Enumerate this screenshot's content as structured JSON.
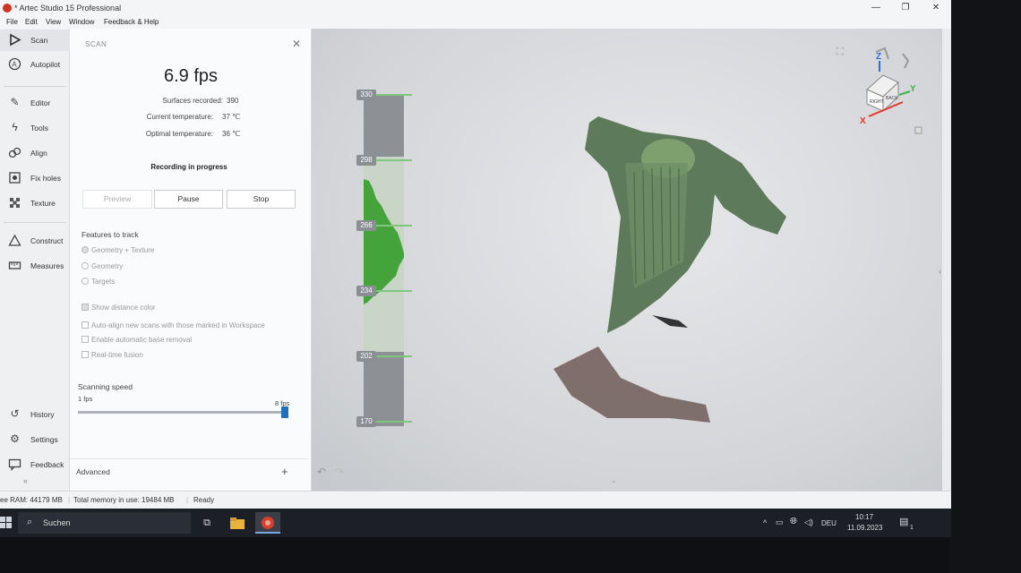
{
  "window": {
    "title": "* Artec Studio 15 Professional"
  },
  "menu": [
    "File",
    "Edit",
    "View",
    "Window",
    "Feedback & Help"
  ],
  "sidebar": {
    "top": [
      {
        "label": "Scan",
        "icon": "play-icon"
      },
      {
        "label": "Autopilot",
        "icon": "autopilot-icon"
      }
    ],
    "middle": [
      {
        "label": "Editor",
        "icon": "pencil-icon"
      },
      {
        "label": "Tools",
        "icon": "lightning-icon"
      },
      {
        "label": "Align",
        "icon": "align-icon"
      },
      {
        "label": "Fix holes",
        "icon": "fix-holes-icon"
      },
      {
        "label": "Texture",
        "icon": "texture-icon"
      }
    ],
    "lower": [
      {
        "label": "Construct",
        "icon": "triangle-icon"
      },
      {
        "label": "Measures",
        "icon": "ruler-icon"
      }
    ],
    "bottom": [
      {
        "label": "History",
        "icon": "history-icon"
      },
      {
        "label": "Settings",
        "icon": "gear-icon"
      },
      {
        "label": "Feedback",
        "icon": "feedback-icon"
      }
    ],
    "collapse": "«"
  },
  "scan": {
    "header": "SCAN",
    "fps": "6.9 fps",
    "surfaces_label": "Surfaces recorded:",
    "surfaces_value": "390",
    "current_temp_label": "Current temperature:",
    "current_temp_value": "37 ℃",
    "optimal_temp_label": "Optimal temperature:",
    "optimal_temp_value": "36 ℃",
    "status": "Recording in progress",
    "buttons": {
      "preview": "Preview",
      "pause": "Pause",
      "stop": "Stop"
    },
    "features_title": "Features to track",
    "features": [
      "Geometry + Texture",
      "Geometry",
      "Targets"
    ],
    "selected_feature": "Geometry + Texture",
    "options": [
      {
        "label": "Show distance color",
        "checked": true
      },
      {
        "label": "Auto-align new scans with those marked in Workspace",
        "checked": false
      },
      {
        "label": "Enable automatic base removal",
        "checked": false
      },
      {
        "label": "Real-time fusion",
        "checked": false
      }
    ],
    "speed_title": "Scanning speed",
    "speed_min": "1 fps",
    "speed_max": "8 fps",
    "speed_fraction": 1.0,
    "advanced": "Advanced",
    "advanced_toggle": "+"
  },
  "viewport": {
    "distance_ticks": [
      "330",
      "298",
      "266",
      "234",
      "202",
      "170"
    ],
    "axis_labels": {
      "z": "Z",
      "y": "Y",
      "x": "X"
    },
    "cube_faces": [
      "RIGHT",
      "BACK"
    ],
    "axis_colors": {
      "x": "#e23a2a",
      "y": "#3bb54a",
      "z": "#2a6fd6"
    },
    "scan_color": "#4a8c3c"
  },
  "status": {
    "free_ram": "ee RAM: 44179 MB",
    "total_memory": "Total memory in use: 19484 MB",
    "state": "Ready"
  },
  "taskbar": {
    "search": "Suchen",
    "language": "DEU",
    "time": "10:17",
    "date": "11.09.2023",
    "notifications": "1"
  }
}
